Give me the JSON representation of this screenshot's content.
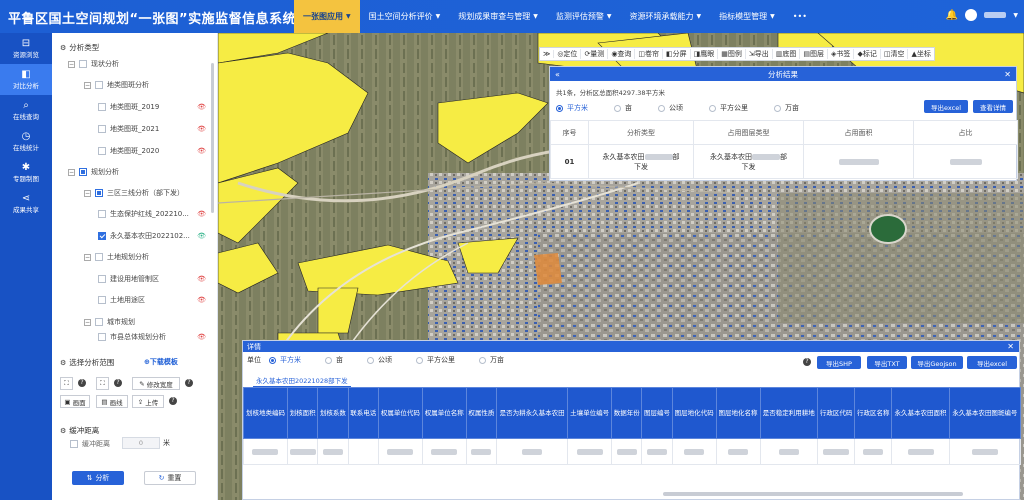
{
  "header": {
    "title": "平鲁区国土空间规划“一张图”实施监督信息系统",
    "nav": [
      {
        "label": "一张图应用",
        "caret": "▼",
        "active": true
      },
      {
        "label": "国土空间分析评价",
        "caret": "▼",
        "active": false
      },
      {
        "label": "规划成果审查与管理",
        "caret": "▼",
        "active": false
      },
      {
        "label": "监测评估预警",
        "caret": "▼",
        "active": false
      },
      {
        "label": "资源环境承载能力",
        "caret": "▼",
        "active": false
      },
      {
        "label": "指标模型管理",
        "caret": "▼",
        "active": false
      },
      {
        "label": "•••",
        "caret": "",
        "active": false
      }
    ],
    "bell": "🔔",
    "user_caret": "▼"
  },
  "rail": [
    {
      "icon": "⊟",
      "label": "资源浏览",
      "active": false
    },
    {
      "icon": "◧",
      "label": "对比分析",
      "active": true
    },
    {
      "icon": "⌕",
      "label": "在线查询",
      "active": false
    },
    {
      "icon": "◷",
      "label": "在线统计",
      "active": false
    },
    {
      "icon": "✱",
      "label": "专题制图",
      "active": false
    },
    {
      "icon": "⋖",
      "label": "成果共享",
      "active": false
    }
  ],
  "left_panel": {
    "analysis_type": "分析类型",
    "tree": {
      "status_quo": "现状分析",
      "landuse_analysis": "地类图斑分析",
      "landuse_2019": "地类图斑_2019",
      "landuse_2021": "地类图斑_2021",
      "landuse_2020": "地类图斑_2020",
      "planning": "规划分析",
      "three_zones": "三区三线分析（部下发）",
      "eco_redline": "生态保护红线_202210...",
      "farmland": "永久基本农田2022102...",
      "land_plan": "土地规划分析",
      "construction_zone": "建设用地管制区",
      "land_use_zone": "土地用途区",
      "city_plan": "城市规划",
      "city_master": "市县总体规划分析"
    },
    "eye_icon": "👁",
    "toggle_minus": "−",
    "select_range": "选择分析范围",
    "download_template": "⊕下载模板",
    "edit_width": "修改宽度",
    "draw_polygon": "画面",
    "draw_line": "画线",
    "upload": "上传",
    "question": "?",
    "buffer_title": "缓冲距离",
    "buffer_distance": "缓冲距离",
    "buffer_value": "0",
    "buffer_unit": "米",
    "analyze": "分析",
    "reset": "重置"
  },
  "map_toolbar": [
    "≫",
    "◎定位",
    "⟳量测",
    "◉查询",
    "◫卷帘",
    "◧分屏",
    "◨鹰眼",
    "▦图例",
    "⇲导出",
    "▥底图",
    "▤图层",
    "◈书签",
    "◆标记",
    "◫清空",
    "▲坐标"
  ],
  "result_panel": {
    "title": "分析结果",
    "collapse": "«",
    "close": "✕",
    "summary": "共1条，分析区总面积4297.38平方米",
    "units": [
      {
        "label": "平方米",
        "selected": true
      },
      {
        "label": "亩",
        "selected": false
      },
      {
        "label": "公顷",
        "selected": false
      },
      {
        "label": "平方公里",
        "selected": false
      },
      {
        "label": "万亩",
        "selected": false
      }
    ],
    "export_excel": "导出excel",
    "view_detail": "查看详情",
    "columns": [
      "序号",
      "分析类型",
      "占用图层类型",
      "占用面积",
      "占比"
    ],
    "rows": [
      {
        "index": "01",
        "type_a": "永久基本农田",
        "type_b": "部",
        "type_c": "下发",
        "layer_a": "永久基本农田",
        "layer_b": "部",
        "layer_c": "下发"
      }
    ]
  },
  "detail_panel": {
    "title": "详情",
    "close": "✕",
    "unit_label": "单位",
    "units": [
      {
        "label": "平方米",
        "selected": true
      },
      {
        "label": "亩",
        "selected": false
      },
      {
        "label": "公顷",
        "selected": false
      },
      {
        "label": "平方公里",
        "selected": false
      },
      {
        "label": "万亩",
        "selected": false
      }
    ],
    "question": "?",
    "export_shp": "导出SHP",
    "export_txt": "导出TXT",
    "export_geojson": "导出Geojson",
    "export_excel": "导出excel",
    "tab": "永久基本农田20221028部下发",
    "columns": [
      "划核地类编码",
      "划核面积",
      "划核系数",
      "联系电话",
      "权属单位代码",
      "权属单位名称",
      "权属性质",
      "是否为耕永久基本农田",
      "土壤单位编号",
      "数据年份",
      "图层编号",
      "图层地化代码",
      "图层地化名称",
      "是否稳定利用耕地",
      "行政区代码",
      "行政区名称",
      "永久基本农田面积",
      "永久基本农田图斑编号"
    ]
  }
}
